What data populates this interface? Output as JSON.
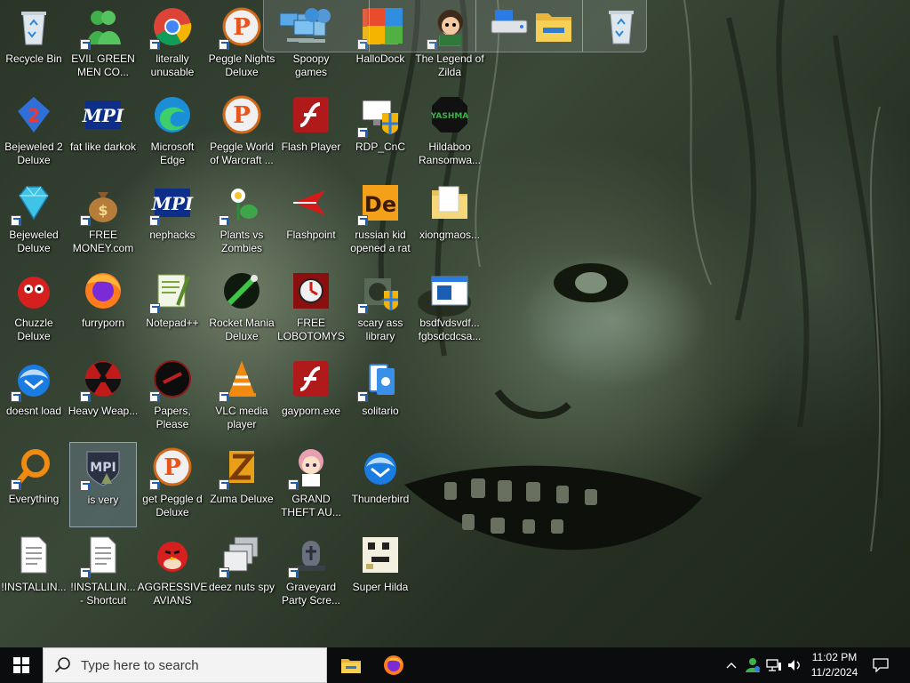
{
  "desktop": {
    "icons": [
      {
        "label": "Recycle Bin",
        "icon": "recycle-bin-icon",
        "shortcut": false
      },
      {
        "label": "EVIL GREEN MEN CO...",
        "icon": "green-men-icon",
        "shortcut": true
      },
      {
        "label": "literally unusable",
        "icon": "chrome-icon",
        "shortcut": true
      },
      {
        "label": "Peggle Nights Deluxe",
        "icon": "peggle-icon",
        "shortcut": true
      },
      {
        "label": "Spoopy games",
        "icon": "network-computers-icon",
        "shortcut": false
      },
      {
        "label": "HalloDock",
        "icon": "hallodock-icon",
        "shortcut": true
      },
      {
        "label": "The Legend of Zilda",
        "icon": "zilda-icon",
        "shortcut": true
      },
      {
        "label": "Bejeweled 2 Deluxe",
        "icon": "bejeweled2-icon",
        "shortcut": false
      },
      {
        "label": "fat like darkok",
        "icon": "mpi-icon",
        "shortcut": false
      },
      {
        "label": "Microsoft Edge",
        "icon": "edge-icon",
        "shortcut": false
      },
      {
        "label": "Peggle World of Warcraft ...",
        "icon": "peggle-icon",
        "shortcut": false
      },
      {
        "label": "Flash Player",
        "icon": "flash-icon",
        "shortcut": false
      },
      {
        "label": "RDP_CnC",
        "icon": "rdp-icon",
        "shortcut": true
      },
      {
        "label": "Hildaboo Ransomwa...",
        "icon": "yashma-icon",
        "shortcut": false
      },
      {
        "label": "Bejeweled Deluxe",
        "icon": "bejeweled-icon",
        "shortcut": true
      },
      {
        "label": "FREE MONEY.com",
        "icon": "money-bag-icon",
        "shortcut": true
      },
      {
        "label": "nephacks",
        "icon": "mpi-icon",
        "shortcut": true
      },
      {
        "label": "Plants vs Zombies",
        "icon": "pvz-icon",
        "shortcut": true
      },
      {
        "label": "Flashpoint",
        "icon": "flashpoint-icon",
        "shortcut": false
      },
      {
        "label": "russian kid opened a rat",
        "icon": "de-icon",
        "shortcut": true
      },
      {
        "label": "xiongmaos...",
        "icon": "folder-icon",
        "shortcut": false
      },
      {
        "label": "Chuzzle Deluxe",
        "icon": "chuzzle-icon",
        "shortcut": false
      },
      {
        "label": "furryporn",
        "icon": "firefox-icon",
        "shortcut": false
      },
      {
        "label": "Notepad++",
        "icon": "notepadpp-icon",
        "shortcut": true
      },
      {
        "label": "Rocket Mania Deluxe",
        "icon": "rocket-mania-icon",
        "shortcut": false
      },
      {
        "label": "FREE LOBOTOMYS",
        "icon": "lobotomy-icon",
        "shortcut": false
      },
      {
        "label": "scary ass library",
        "icon": "library-icon",
        "shortcut": true
      },
      {
        "label": "bsdfvdsvdf... fgbsdcdcsa...",
        "icon": "window-icon",
        "shortcut": false
      },
      {
        "label": "doesnt load",
        "icon": "thunderbird-icon",
        "shortcut": true
      },
      {
        "label": "Heavy Weap...",
        "icon": "radiation-icon",
        "shortcut": true
      },
      {
        "label": "Papers, Please",
        "icon": "papers-please-icon",
        "shortcut": true
      },
      {
        "label": "VLC media player",
        "icon": "vlc-icon",
        "shortcut": true
      },
      {
        "label": "gayporn.exe",
        "icon": "flash-icon",
        "shortcut": false
      },
      {
        "label": "solitario",
        "icon": "solitario-icon",
        "shortcut": true
      },
      {
        "label": "Everything",
        "icon": "everything-search-icon",
        "shortcut": true
      },
      {
        "label": "is very",
        "icon": "mpi-shield-icon",
        "shortcut": true
      },
      {
        "label": "get Peggle d Deluxe",
        "icon": "peggle-icon",
        "shortcut": true
      },
      {
        "label": "Zuma Deluxe",
        "icon": "zuma-icon",
        "shortcut": true
      },
      {
        "label": "GRAND THEFT AU...",
        "icon": "anime-girl-icon",
        "shortcut": true
      },
      {
        "label": "Thunderbird",
        "icon": "thunderbird-icon",
        "shortcut": false
      },
      {
        "label": "!INSTALLIN...",
        "icon": "text-file-icon",
        "shortcut": false
      },
      {
        "label": "!INSTALLIN... - Shortcut",
        "icon": "text-file-icon",
        "shortcut": true
      },
      {
        "label": "AGGRESSIVE AVIANS",
        "icon": "angry-bird-icon",
        "shortcut": false
      },
      {
        "label": "deez nuts spy",
        "icon": "stacked-windows-icon",
        "shortcut": true
      },
      {
        "label": "Graveyard Party Scre...",
        "icon": "graveyard-icon",
        "shortcut": true
      },
      {
        "label": "Super Hilda",
        "icon": "pixel-hilda-icon",
        "shortcut": false
      }
    ]
  },
  "dock": {
    "items": [
      "network-computers-icon",
      "hallodock-icon",
      "zilda-icon",
      "drive-icon",
      "file-explorer-icon",
      "recycle-bin-icon"
    ]
  },
  "taskbar": {
    "search_placeholder": "Type here to search",
    "pinned": [
      "file-explorer-icon",
      "firefox-icon"
    ],
    "tray": [
      "chevron-up-icon",
      "people-icon",
      "network-icon",
      "volume-icon"
    ],
    "time": "11:02 PM",
    "date": "11/2/2024",
    "notification_icon": "action-center-icon"
  }
}
